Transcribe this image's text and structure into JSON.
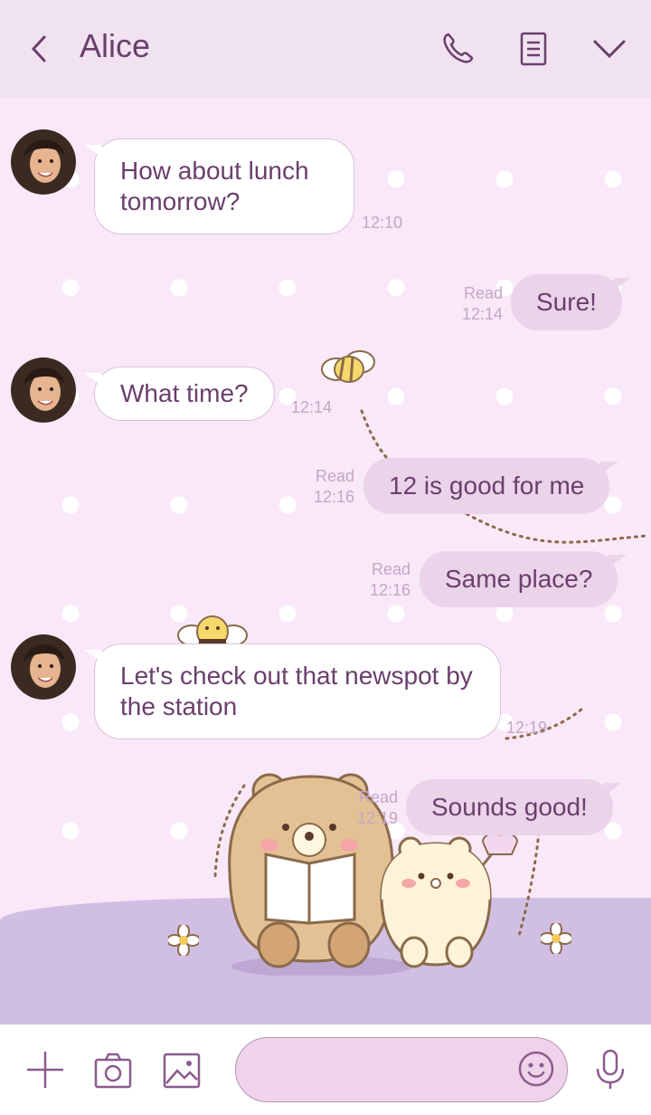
{
  "header": {
    "title": "Alice",
    "back_icon": "chevron-left-icon",
    "call_icon": "phone-icon",
    "notes_icon": "notes-icon",
    "menu_icon": "chevron-down-icon"
  },
  "messages": [
    {
      "dir": "in",
      "text": "How about lunch tomorrow?",
      "time": "12:10"
    },
    {
      "dir": "out",
      "text": "Sure!",
      "status": "Read",
      "time": "12:14"
    },
    {
      "dir": "in",
      "text": "What time?",
      "time": "12:14"
    },
    {
      "dir": "out",
      "text": "12 is good for me",
      "status": "Read",
      "time": "12:16"
    },
    {
      "dir": "out",
      "text": "Same place?",
      "status": "Read",
      "time": "12:16"
    },
    {
      "dir": "in",
      "text": "Let's check out that newspot by the station",
      "time": "12:19"
    },
    {
      "dir": "out",
      "text": "Sounds good!",
      "status": "Read",
      "time": "12:19"
    }
  ],
  "composer": {
    "placeholder": "",
    "value": "",
    "add_icon": "plus-icon",
    "camera_icon": "camera-icon",
    "gallery_icon": "image-icon",
    "emoji_icon": "smiley-icon",
    "mic_icon": "microphone-icon"
  },
  "colors": {
    "header_bg": "#f1e2f1",
    "chat_bg": "#f8e8f8",
    "text": "#6a3f6c",
    "out_bubble": "#ebd4ea",
    "meta_text": "#c5a6c5",
    "ground": "#d1bfe3"
  }
}
